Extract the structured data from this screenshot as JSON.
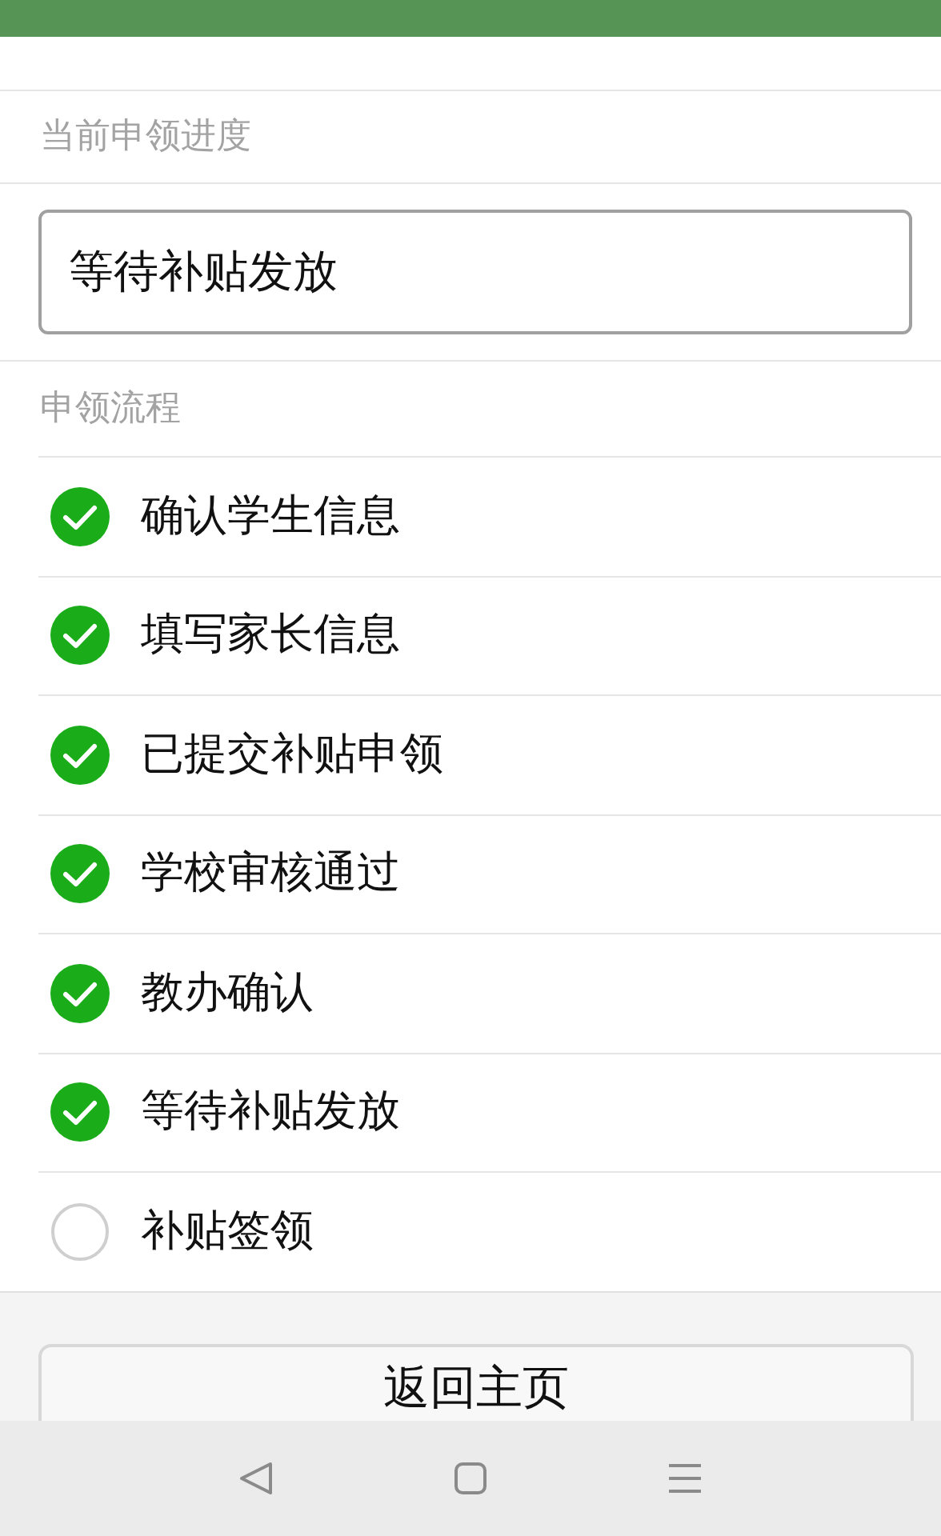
{
  "progress": {
    "label": "当前申领进度",
    "value": "等待补贴发放"
  },
  "steps_title": "申领流程",
  "steps": [
    {
      "label": "确认学生信息",
      "checked": true
    },
    {
      "label": "填写家长信息",
      "checked": true
    },
    {
      "label": "已提交补贴申领",
      "checked": true
    },
    {
      "label": "学校审核通过",
      "checked": true
    },
    {
      "label": "教办确认",
      "checked": true
    },
    {
      "label": "等待补贴发放",
      "checked": true
    },
    {
      "label": "补贴签领",
      "checked": false
    }
  ],
  "buttons": [
    "返回主页"
  ]
}
